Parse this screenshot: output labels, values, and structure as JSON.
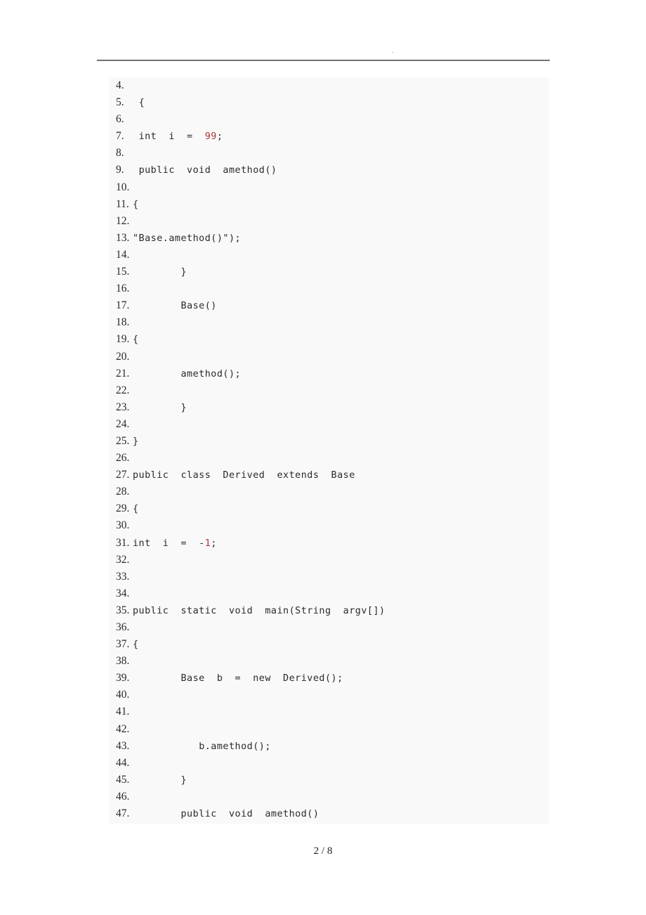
{
  "page": {
    "footer_text": "2 / 8",
    "header_mark": "."
  },
  "code_block": {
    "language": "java",
    "first_line_number": 4,
    "last_line_number": 47,
    "accent_number_color": "#b43434",
    "background_color": "#f9f9f9",
    "text_color": "#2a2a2a",
    "lines": [
      {
        "n": "4.",
        "indent": "",
        "pre": "",
        "red": "",
        "post": ""
      },
      {
        "n": "5.",
        "indent": " ",
        "pre": "{",
        "red": "",
        "post": ""
      },
      {
        "n": "6.",
        "indent": "",
        "pre": "",
        "red": "",
        "post": ""
      },
      {
        "n": "7.",
        "indent": " ",
        "pre": "int  i  =  ",
        "red": "99",
        "post": ";"
      },
      {
        "n": "8.",
        "indent": "",
        "pre": "",
        "red": "",
        "post": ""
      },
      {
        "n": "9.",
        "indent": " ",
        "pre": "public  void  amethod()",
        "red": "",
        "post": ""
      },
      {
        "n": "10.",
        "indent": "",
        "pre": "",
        "red": "",
        "post": ""
      },
      {
        "n": "11.",
        "indent": "",
        "pre": "{",
        "red": "",
        "post": ""
      },
      {
        "n": "12.",
        "indent": "",
        "pre": "",
        "red": "",
        "post": ""
      },
      {
        "n": "13.",
        "indent": "",
        "pre": "\"Base.amethod()\");",
        "red": "",
        "post": ""
      },
      {
        "n": "14.",
        "indent": "",
        "pre": "",
        "red": "",
        "post": ""
      },
      {
        "n": "15.",
        "indent": "        ",
        "pre": "}",
        "red": "",
        "post": ""
      },
      {
        "n": "16.",
        "indent": "",
        "pre": "",
        "red": "",
        "post": ""
      },
      {
        "n": "17.",
        "indent": "        ",
        "pre": "Base()",
        "red": "",
        "post": ""
      },
      {
        "n": "18.",
        "indent": "",
        "pre": "",
        "red": "",
        "post": ""
      },
      {
        "n": "19.",
        "indent": "",
        "pre": "{",
        "red": "",
        "post": ""
      },
      {
        "n": "20.",
        "indent": "",
        "pre": "",
        "red": "",
        "post": ""
      },
      {
        "n": "21.",
        "indent": "        ",
        "pre": "amethod();",
        "red": "",
        "post": ""
      },
      {
        "n": "22.",
        "indent": "",
        "pre": "",
        "red": "",
        "post": ""
      },
      {
        "n": "23.",
        "indent": "        ",
        "pre": "}",
        "red": "",
        "post": ""
      },
      {
        "n": "24.",
        "indent": "",
        "pre": "",
        "red": "",
        "post": ""
      },
      {
        "n": "25.",
        "indent": "",
        "pre": "}",
        "red": "",
        "post": ""
      },
      {
        "n": "26.",
        "indent": "",
        "pre": "",
        "red": "",
        "post": ""
      },
      {
        "n": "27.",
        "indent": "",
        "pre": "public  class  Derived  extends  Base",
        "red": "",
        "post": ""
      },
      {
        "n": "28.",
        "indent": "",
        "pre": "",
        "red": "",
        "post": ""
      },
      {
        "n": "29.",
        "indent": "",
        "pre": "{",
        "red": "",
        "post": ""
      },
      {
        "n": "30.",
        "indent": "",
        "pre": "",
        "red": "",
        "post": ""
      },
      {
        "n": "31.",
        "indent": "",
        "pre": "int  i  =  -",
        "red": "1",
        "post": ";"
      },
      {
        "n": "32.",
        "indent": "",
        "pre": "",
        "red": "",
        "post": ""
      },
      {
        "n": "33.",
        "indent": "",
        "pre": "",
        "red": "",
        "post": ""
      },
      {
        "n": "34.",
        "indent": "",
        "pre": "",
        "red": "",
        "post": ""
      },
      {
        "n": "35.",
        "indent": "",
        "pre": "public  static  void  main(String  argv[])",
        "red": "",
        "post": ""
      },
      {
        "n": "36.",
        "indent": "",
        "pre": "",
        "red": "",
        "post": ""
      },
      {
        "n": "37.",
        "indent": "",
        "pre": "{",
        "red": "",
        "post": ""
      },
      {
        "n": "38.",
        "indent": "",
        "pre": "",
        "red": "",
        "post": ""
      },
      {
        "n": "39.",
        "indent": "        ",
        "pre": "Base  b  =  new  Derived();",
        "red": "",
        "post": ""
      },
      {
        "n": "40.",
        "indent": "",
        "pre": "",
        "red": "",
        "post": ""
      },
      {
        "n": "41.",
        "indent": "",
        "pre": "",
        "red": "",
        "post": ""
      },
      {
        "n": "42.",
        "indent": "",
        "pre": "",
        "red": "",
        "post": ""
      },
      {
        "n": "43.",
        "indent": "           ",
        "pre": "b.amethod();",
        "red": "",
        "post": ""
      },
      {
        "n": "44.",
        "indent": "",
        "pre": "",
        "red": "",
        "post": ""
      },
      {
        "n": "45.",
        "indent": "        ",
        "pre": "}",
        "red": "",
        "post": ""
      },
      {
        "n": "46.",
        "indent": "",
        "pre": "",
        "red": "",
        "post": ""
      },
      {
        "n": "47.",
        "indent": "        ",
        "pre": "public  void  amethod()",
        "red": "",
        "post": ""
      }
    ]
  }
}
